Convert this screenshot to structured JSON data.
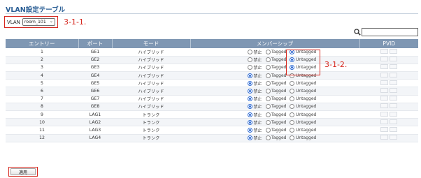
{
  "page": {
    "title": "VLAN設定テーブル"
  },
  "vlan_selector": {
    "label": "VLAN",
    "selected": "room_101"
  },
  "annotations": {
    "selector_note": "3-1-1.",
    "membership_note": "3-1-2."
  },
  "table": {
    "headers": [
      "エントリー",
      "ポート",
      "モード",
      "メンバーシップ",
      "PVID"
    ],
    "membership_options": [
      "禁止",
      "Tagged",
      "Untagged"
    ],
    "rows": [
      {
        "entry": "1",
        "port": "GE1",
        "mode": "ハイブリッド",
        "membership": "Untagged"
      },
      {
        "entry": "2",
        "port": "GE2",
        "mode": "ハイブリッド",
        "membership": "Untagged"
      },
      {
        "entry": "3",
        "port": "GE3",
        "mode": "ハイブリッド",
        "membership": "Untagged"
      },
      {
        "entry": "4",
        "port": "GE4",
        "mode": "ハイブリッド",
        "membership": "禁止"
      },
      {
        "entry": "5",
        "port": "GE5",
        "mode": "ハイブリッド",
        "membership": "禁止"
      },
      {
        "entry": "6",
        "port": "GE6",
        "mode": "ハイブリッド",
        "membership": "禁止"
      },
      {
        "entry": "7",
        "port": "GE7",
        "mode": "ハイブリッド",
        "membership": "禁止"
      },
      {
        "entry": "8",
        "port": "GE8",
        "mode": "ハイブリッド",
        "membership": "禁止"
      },
      {
        "entry": "9",
        "port": "LAG1",
        "mode": "トランク",
        "membership": "禁止"
      },
      {
        "entry": "10",
        "port": "LAG2",
        "mode": "トランク",
        "membership": "禁止"
      },
      {
        "entry": "11",
        "port": "LAG3",
        "mode": "トランク",
        "membership": "禁止"
      },
      {
        "entry": "12",
        "port": "LAG4",
        "mode": "トランク",
        "membership": "禁止"
      }
    ]
  },
  "buttons": {
    "apply": "適用"
  },
  "colors": {
    "header_bg": "#7f97b3",
    "title": "#2a5e95",
    "annotation": "#d6281f",
    "radio_checked": "#2f6bd3"
  },
  "icons": {
    "search": "search-icon"
  }
}
